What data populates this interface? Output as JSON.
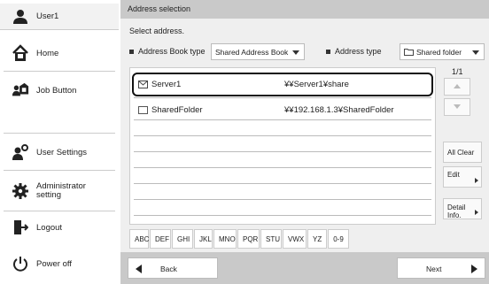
{
  "sidebar": {
    "user": "User1",
    "home": "Home",
    "job_button": "Job Button",
    "user_settings": "User Settings",
    "admin_setting": "Administrator setting",
    "logout": "Logout",
    "power_off": "Power off"
  },
  "main": {
    "title": "Address selection",
    "prompt": "Select address.",
    "filter_address_book_label": "Address Book type",
    "filter_address_book_value": "Shared Address Book",
    "filter_address_type_label": "Address type",
    "filter_address_type_value": "Shared folder",
    "rows": [
      {
        "name": "Server1",
        "address": "¥¥Server1¥share"
      },
      {
        "name": "SharedFolder",
        "address": "¥¥192.168.1.3¥SharedFolder"
      }
    ],
    "page": "1/1",
    "buttons": {
      "all_clear": "All Clear",
      "edit": "Edit",
      "detail_info": "Detail Info."
    },
    "tabs": [
      "ABC",
      "DEF",
      "GHI",
      "JKL",
      "MNO",
      "PQR",
      "STU",
      "VWX",
      "YZ",
      "0-9"
    ],
    "back": "Back",
    "next": "Next"
  }
}
